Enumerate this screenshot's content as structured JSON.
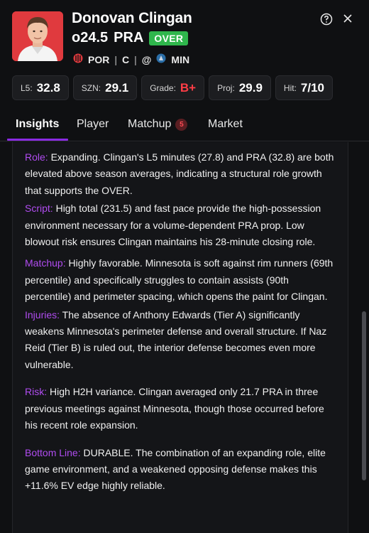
{
  "player": {
    "name": "Donovan Clingan",
    "line": "o24.5",
    "stat_type": "PRA",
    "pick": "OVER",
    "team": "POR",
    "position": "C",
    "divider": "|",
    "at": "@",
    "opponent": "MIN"
  },
  "header_icons": {
    "help": "help-circle-icon",
    "close": "close-icon",
    "team_logo": "blazers-logo-icon",
    "opponent_logo": "timberwolves-logo-icon"
  },
  "stats": [
    {
      "label": "L5:",
      "value": "32.8"
    },
    {
      "label": "SZN:",
      "value": "29.1"
    },
    {
      "label": "Grade:",
      "value": "B+"
    },
    {
      "label": "Proj:",
      "value": "29.9"
    },
    {
      "label": "Hit:",
      "value": "7/10"
    }
  ],
  "tabs": [
    {
      "label": "Insights",
      "active": true
    },
    {
      "label": "Player"
    },
    {
      "label": "Matchup",
      "badge": "5"
    },
    {
      "label": "Market"
    }
  ],
  "insights": [
    {
      "key": "Role:",
      "text": "Expanding. Clingan's L5 minutes (27.8) and PRA (32.8) are both elevated above season averages, indicating a structural role growth that supports the OVER."
    },
    {
      "key": "Script:",
      "text": "High total (231.5) and fast pace provide the high-possession environment necessary for a volume-dependent PRA prop. Low blowout risk ensures Clingan maintains his 28-minute closing role."
    },
    {
      "key": "Matchup:",
      "text": "Highly favorable. Minnesota is soft against rim runners (69th percentile) and specifically struggles to contain assists (90th percentile) and perimeter spacing, which opens the paint for Clingan."
    },
    {
      "key": "Injuries:",
      "text": "The absence of Anthony Edwards (Tier A) significantly weakens Minnesota's perimeter defense and overall structure. If Naz Reid (Tier B) is ruled out, the interior defense becomes even more vulnerable."
    },
    {
      "key": "Risk:",
      "text": "High H2H variance. Clingan averaged only 21.7 PRA in three previous meetings against Minnesota, though those occurred before his recent role expansion."
    },
    {
      "key": "Bottom Line:",
      "text": "DURABLE. The combination of an expanding role, elite game environment, and a weakened opposing defense makes this +11.6% EV edge highly reliable."
    }
  ],
  "colors": {
    "accent": "#8a2be2",
    "key_text": "#b04cf0",
    "over_badge": "#2fb64c",
    "grade": "#ff3d46",
    "blazers_red": "#e03a3e"
  }
}
